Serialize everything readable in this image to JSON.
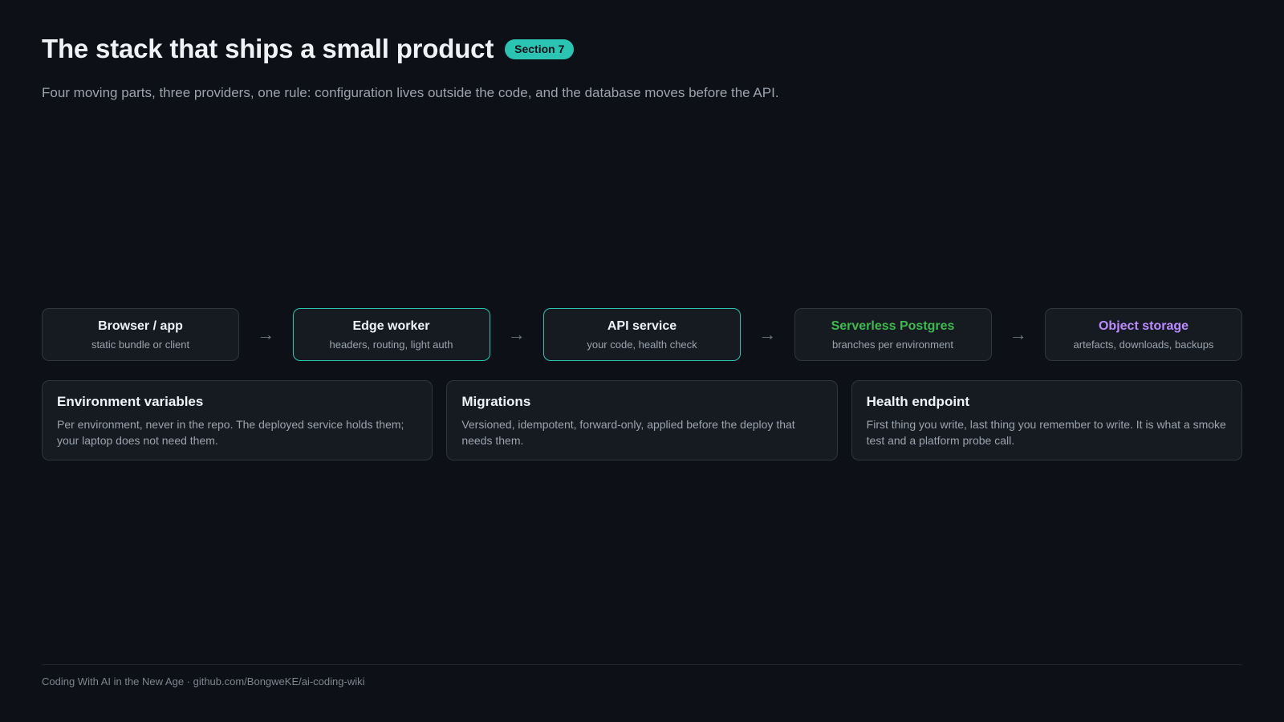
{
  "header": {
    "title": "The stack that ships a small product",
    "badge": "Section 7",
    "subtitle": "Four moving parts, three providers, one rule: configuration lives outside the code, and the database moves before the API."
  },
  "flow": {
    "nodes": [
      {
        "title": "Browser / app",
        "subtitle": "static bundle or client",
        "title_color": "#f0f3f6"
      },
      {
        "title": "Edge worker",
        "subtitle": "headers, routing, light auth",
        "title_color": "#f0f3f6"
      },
      {
        "title": "API service",
        "subtitle": "your code, health check",
        "title_color": "#f0f3f6"
      },
      {
        "title": "Serverless Postgres",
        "subtitle": "branches per environment",
        "title_color": "#3fb950"
      },
      {
        "title": "Object storage",
        "subtitle": "artefacts, downloads, backups",
        "title_color": "#bc8cff"
      }
    ],
    "arrow": "→",
    "accent_color": "#2bc4b2"
  },
  "cards": [
    {
      "title": "Environment variables",
      "body": "Per environment, never in the repo. The deployed service holds them; your laptop does not need them."
    },
    {
      "title": "Migrations",
      "body": "Versioned, idempotent, forward-only, applied before the deploy that needs them."
    },
    {
      "title": "Health endpoint",
      "body": "First thing you write, last thing you remember to write. It is what a smoke test and a platform probe call."
    }
  ],
  "footer": {
    "text": "Coding With AI in the New Age · github.com/BongweKE/ai-coding-wiki"
  }
}
